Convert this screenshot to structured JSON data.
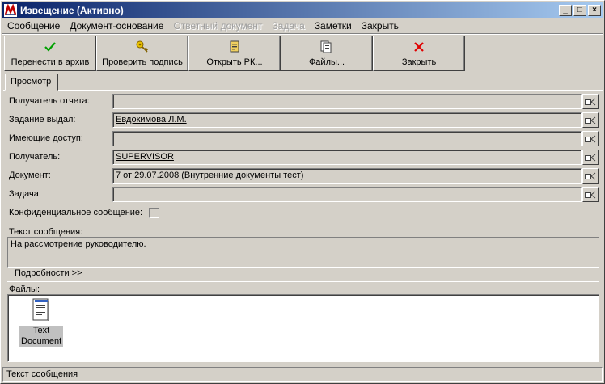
{
  "window": {
    "title": "Извещение (Активно)",
    "controls": {
      "minimize": "_",
      "maximize": "□",
      "close": "×"
    }
  },
  "menu": [
    {
      "label": "Сообщение",
      "disabled": false
    },
    {
      "label": "Документ-основание",
      "disabled": false
    },
    {
      "label": "Ответный документ",
      "disabled": true
    },
    {
      "label": "Задача",
      "disabled": true
    },
    {
      "label": "Заметки",
      "disabled": false
    },
    {
      "label": "Закрыть",
      "disabled": false
    }
  ],
  "toolbar": {
    "archive": {
      "label": "Перенести в архив",
      "icon": "green-checkmark-icon"
    },
    "verify": {
      "label": "Проверить подпись",
      "icon": "key-icon"
    },
    "open_rk": {
      "label": "Открыть РК...",
      "icon": "document-card-icon"
    },
    "files": {
      "label": "Файлы...",
      "icon": "files-icon"
    },
    "close": {
      "label": "Закрыть",
      "icon": "red-x-icon"
    }
  },
  "tabs": [
    {
      "label": "Просмотр"
    }
  ],
  "form": {
    "report_recipient": {
      "label": "Получатель отчета:",
      "value": ""
    },
    "task_issuer": {
      "label": "Задание выдал:",
      "value": "Евдокимова Л.М."
    },
    "access_holders": {
      "label": "Имеющие доступ:",
      "value": ""
    },
    "recipient": {
      "label": "Получатель:",
      "value": "SUPERVISOR"
    },
    "document": {
      "label": "Документ:",
      "value": "7 от 29.07.2008 (Внутренние документы  тест)"
    },
    "task": {
      "label": "Задача:",
      "value": ""
    },
    "confidential": {
      "label": "Конфиденциальное сообщение:",
      "checked": false
    }
  },
  "message": {
    "label": "Текст сообщения:",
    "text": "На рассмотрение руководителю.",
    "details_label": "Подробности >>"
  },
  "files": {
    "label": "Файлы:",
    "items": [
      {
        "name_line1": "Text",
        "name_line2": "Document",
        "icon": "text-document-icon"
      }
    ]
  },
  "statusbar": {
    "text": "Текст сообщения"
  },
  "colors": {
    "title_start": "#0a246a",
    "title_end": "#a6caf0",
    "face": "#d4d0c8"
  }
}
